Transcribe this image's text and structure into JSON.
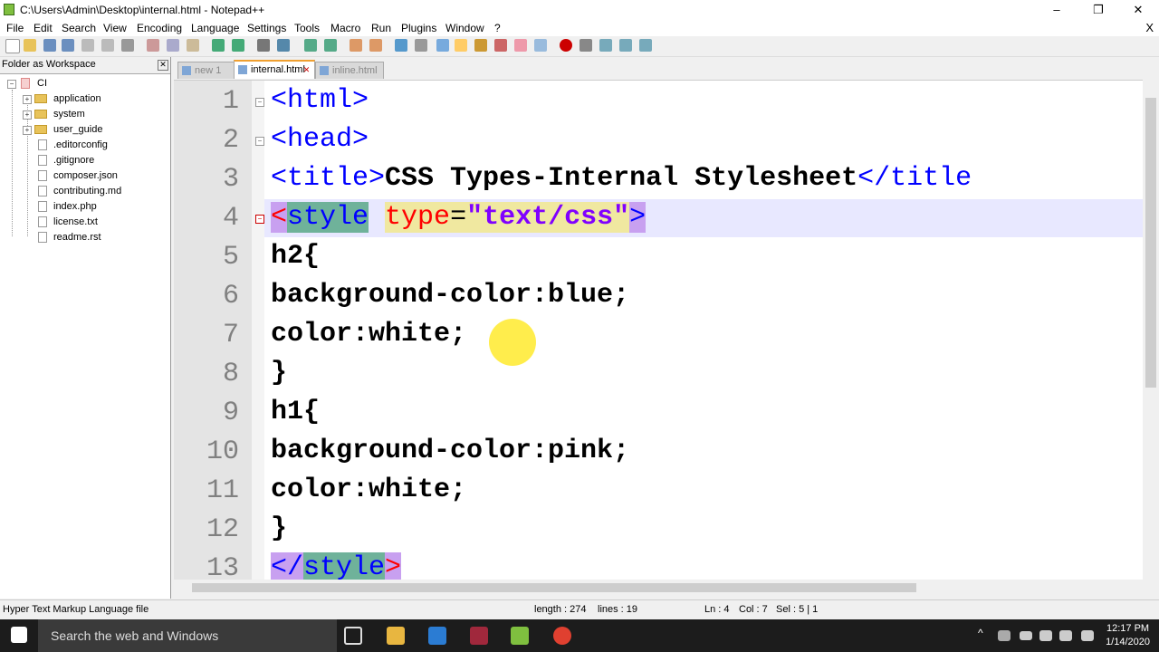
{
  "window": {
    "title": "C:\\Users\\Admin\\Desktop\\internal.html - Notepad++",
    "controls": [
      "–",
      "❐",
      "✕"
    ]
  },
  "menu": {
    "items": [
      "File",
      "Edit",
      "Search",
      "View",
      "Encoding",
      "Language",
      "Settings",
      "Tools",
      "Macro",
      "Run",
      "Plugins",
      "Window",
      "?"
    ],
    "close": "X"
  },
  "workspace": {
    "title": "Folder as Workspace",
    "close": "✕",
    "root": "CI",
    "folders": [
      "application",
      "system",
      "user_guide"
    ],
    "files": [
      ".editorconfig",
      ".gitignore",
      "composer.json",
      "contributing.md",
      "index.php",
      "license.txt",
      "readme.rst"
    ]
  },
  "tabs": [
    {
      "label": "new 1",
      "active": false
    },
    {
      "label": "internal.html",
      "active": true
    },
    {
      "label": "inline.html",
      "active": false
    }
  ],
  "editor": {
    "line_numbers": [
      "1",
      "2",
      "3",
      "4",
      "5",
      "6",
      "7",
      "8",
      "9",
      "10",
      "11",
      "12",
      "13"
    ],
    "lines": {
      "l1": "<html>",
      "l2": "<head>",
      "l3_open": "<title>",
      "l3_text": "CSS Types-Internal Stylesheet",
      "l3_close": "</title",
      "l4_lt": "<",
      "l4_tag": "style",
      "l4_attr": "type",
      "l4_eq": "=",
      "l4_val": "\"text/css\"",
      "l4_gt": ">",
      "l5": "h2{",
      "l6": "background-color:blue;",
      "l7": "color:white;",
      "l8": "}",
      "l9": "h1{",
      "l10": "background-color:pink;",
      "l11": "color:white;",
      "l12": "}",
      "l13_open": "</",
      "l13_tag": "style",
      "l13_gt": ">"
    }
  },
  "status": {
    "file_type": "Hyper Text Markup Language file",
    "length": "length : 274",
    "lines": "lines : 19",
    "ln": "Ln : 4",
    "col": "Col : 7",
    "sel": "Sel : 5 | 1"
  },
  "taskbar": {
    "search_placeholder": "Search the web and Windows",
    "time": "12:17 PM",
    "date": "1/14/2020"
  }
}
